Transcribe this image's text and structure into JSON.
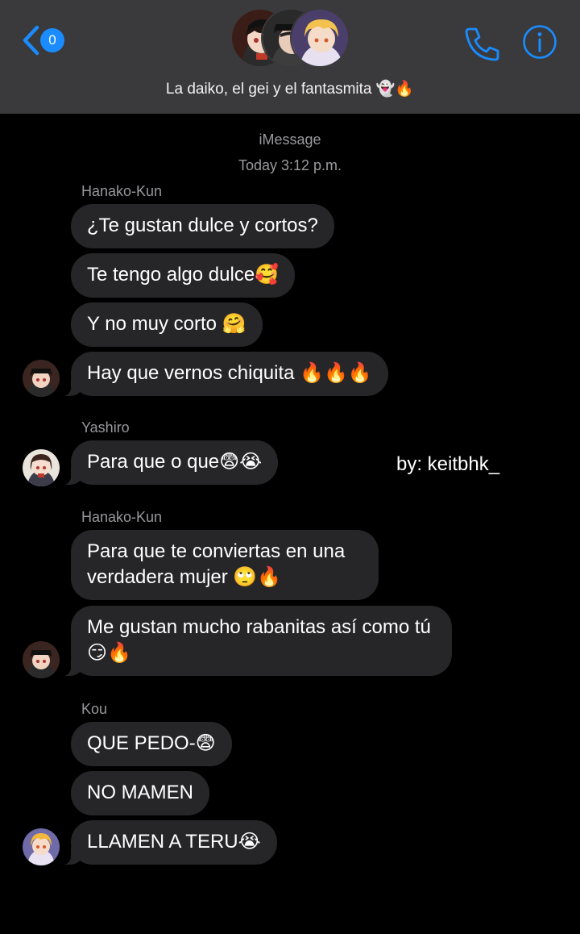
{
  "header": {
    "unread_count": "0",
    "title": "La daiko, el gei y el fantasmita 👻🔥",
    "avatars": [
      "hanako-avatar",
      "tsukasa-avatar",
      "kou-avatar"
    ],
    "accent_color": "#1a8cff"
  },
  "service": {
    "label": "iMessage",
    "timestamp": "Today 3:12 p.m."
  },
  "messages": [
    {
      "sender": "Hanako-Kun"
    },
    {
      "text": "¿Te gustan dulce y cortos?"
    },
    {
      "text": "Te tengo algo dulce🥰"
    },
    {
      "text": "Y no muy corto 🤗"
    },
    {
      "text": "Hay que vernos chiquita 🔥🔥🔥"
    },
    {
      "sender": "Yashiro"
    },
    {
      "text": "Para que o que😨😭"
    },
    {
      "sender": "Hanako-Kun"
    },
    {
      "text": "Para que te conviertas en una verdadera mujer 🙄🔥"
    },
    {
      "text": "Me gustan mucho rabanitas así como tú 😏🔥"
    },
    {
      "sender": "Kou"
    },
    {
      "text": "QUE PEDO-😨"
    },
    {
      "text": "NO MAMEN"
    },
    {
      "text": "LLAMEN A TERU😭"
    }
  ],
  "watermark": "by: keitbhk_"
}
